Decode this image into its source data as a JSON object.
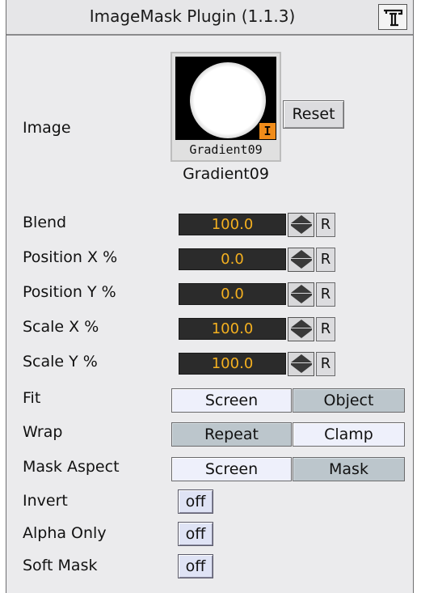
{
  "header": {
    "title": "ImageMask Plugin (1.1.3)",
    "icon": "plugin-info-icon"
  },
  "image": {
    "label": "Image",
    "thumbnail_caption": "Gradient09",
    "thumbnail_badge": "I",
    "name": "Gradient09",
    "reset_label": "Reset"
  },
  "fields": [
    {
      "label": "Blend",
      "value": "100.0",
      "reset": "R"
    },
    {
      "label": "Position X %",
      "value": "0.0",
      "reset": "R"
    },
    {
      "label": "Position Y %",
      "value": "0.0",
      "reset": "R"
    },
    {
      "label": "Scale X %",
      "value": "100.0",
      "reset": "R"
    },
    {
      "label": "Scale Y %",
      "value": "100.0",
      "reset": "R"
    }
  ],
  "fit": {
    "label": "Fit",
    "options": [
      "Screen",
      "Object"
    ],
    "selected": "Screen"
  },
  "wrap": {
    "label": "Wrap",
    "options": [
      "Repeat",
      "Clamp"
    ],
    "selected": "Clamp"
  },
  "mask_aspect": {
    "label": "Mask Aspect",
    "options": [
      "Screen",
      "Mask"
    ],
    "selected": "Screen"
  },
  "toggles": [
    {
      "label": "Invert",
      "value": "off"
    },
    {
      "label": "Alpha Only",
      "value": "off"
    },
    {
      "label": "Soft Mask",
      "value": "off"
    }
  ],
  "colors": {
    "panel_bg": "#ebebed",
    "value_bg": "#2b2b2b",
    "value_text": "#f4b020",
    "segment_active": "#eef0fb",
    "segment_inactive": "#bcc6cc",
    "badge": "#f08c1a"
  }
}
